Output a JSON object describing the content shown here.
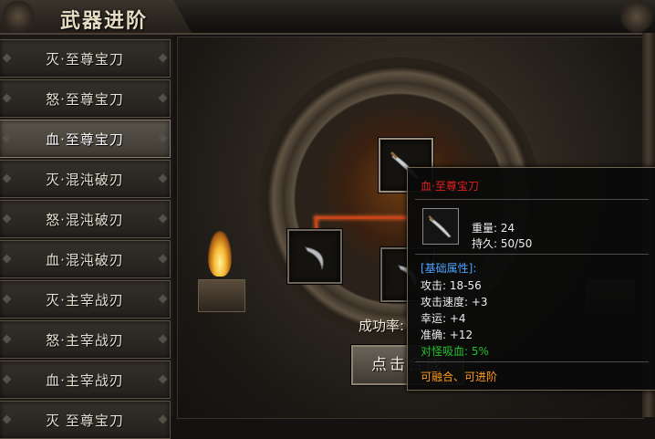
{
  "header": {
    "title": "武器进阶"
  },
  "sidebar": {
    "items": [
      {
        "label": "灭·至尊宝刀",
        "active": false
      },
      {
        "label": "怒·至尊宝刀",
        "active": false
      },
      {
        "label": "血·至尊宝刀",
        "active": true
      },
      {
        "label": "灭·混沌破刃",
        "active": false
      },
      {
        "label": "怒·混沌破刃",
        "active": false
      },
      {
        "label": "血·混沌破刃",
        "active": false
      },
      {
        "label": "灭·主宰战刃",
        "active": false
      },
      {
        "label": "怒·主宰战刃",
        "active": false
      },
      {
        "label": "血·主宰战刃",
        "active": false
      },
      {
        "label": "灭 至尊宝刀",
        "active": false
      }
    ]
  },
  "main": {
    "success_rate_label": "成功率:",
    "success_rate_value": "",
    "synthesize_button_label": "点击合成"
  },
  "tooltip": {
    "item_name": "血·至尊宝刀",
    "weight_label": "重量: 24",
    "durability_label": "持久: 50/50",
    "section_title": "[基础属性]:",
    "stats": [
      {
        "text": "攻击: 18-56",
        "style": "normal"
      },
      {
        "text": "攻击速度: +3",
        "style": "normal"
      },
      {
        "text": "幸运: +4",
        "style": "normal"
      },
      {
        "text": "准确: +12",
        "style": "normal"
      },
      {
        "text": "对怪吸血: 5%",
        "style": "green"
      }
    ],
    "footer": "可融合、可进阶"
  },
  "icons": {
    "blade": "curved-blade-icon",
    "sickle": "sickle-blade-icon"
  },
  "colors": {
    "item_name": "#e02020",
    "section": "#4aa3ff",
    "bonus_stat": "#22c02a",
    "footer": "#ff9a1a",
    "success_rate": "#25c03a"
  }
}
